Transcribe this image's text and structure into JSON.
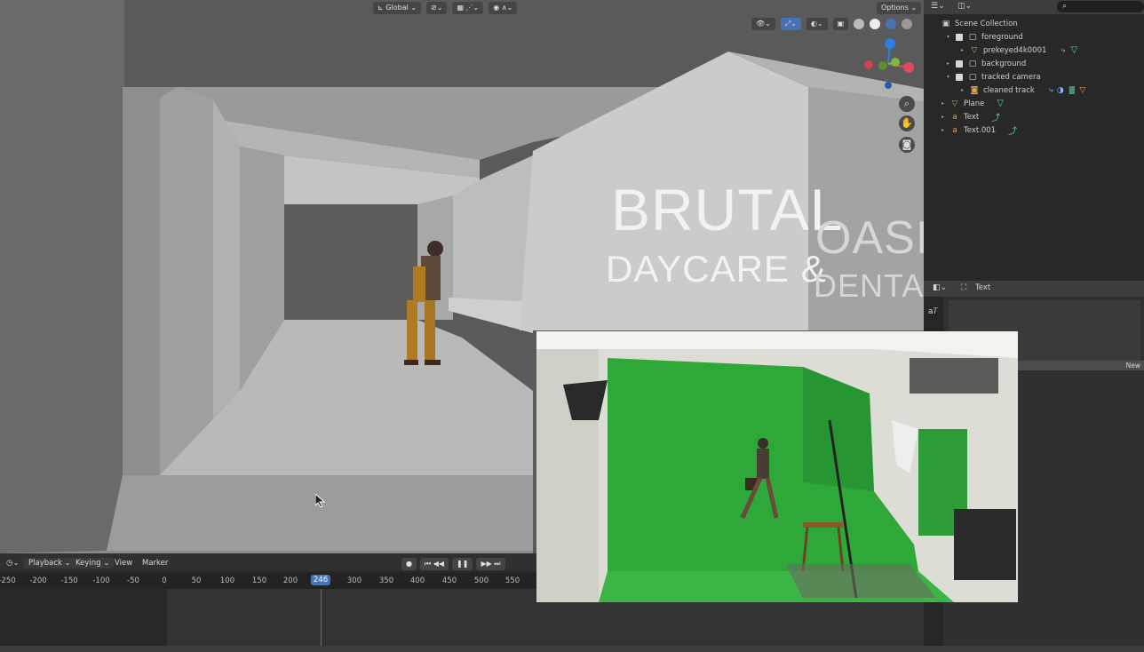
{
  "viewport": {
    "header": {
      "orientation_label": "Global",
      "options_label": "Options"
    },
    "sign": {
      "line1_left": "BRUTAL",
      "line1_right": "OASIS",
      "line2_left": "DAYCARE &",
      "line2_right": "DENTAL"
    },
    "icons": [
      "zoom-icon",
      "hand-pan-icon",
      "camera-view-icon",
      "mouse-cursor-icon"
    ]
  },
  "outliner": {
    "root": "Scene Collection",
    "items": [
      {
        "label": "foreground"
      },
      {
        "label": "prekeyed4k0001"
      },
      {
        "label": "background"
      },
      {
        "label": "tracked camera"
      },
      {
        "label": "cleaned track"
      },
      {
        "label": "Plane"
      },
      {
        "label": "Text"
      },
      {
        "label": "Text.001"
      }
    ]
  },
  "properties": {
    "object_name": "Text",
    "new_button": "New"
  },
  "timeline": {
    "menus": [
      "Playback",
      "Keying",
      "View",
      "Marker"
    ],
    "ruler": [
      "-250",
      "-200",
      "-150",
      "-100",
      "-50",
      "0",
      "50",
      "100",
      "150",
      "200",
      "246",
      "300",
      "350",
      "400",
      "450",
      "500",
      "550"
    ],
    "current_frame": "246"
  },
  "colors": {
    "current_frame": "#4772b3",
    "green_screen": "#2fa83a",
    "header_bg": "#3d3d3d"
  }
}
